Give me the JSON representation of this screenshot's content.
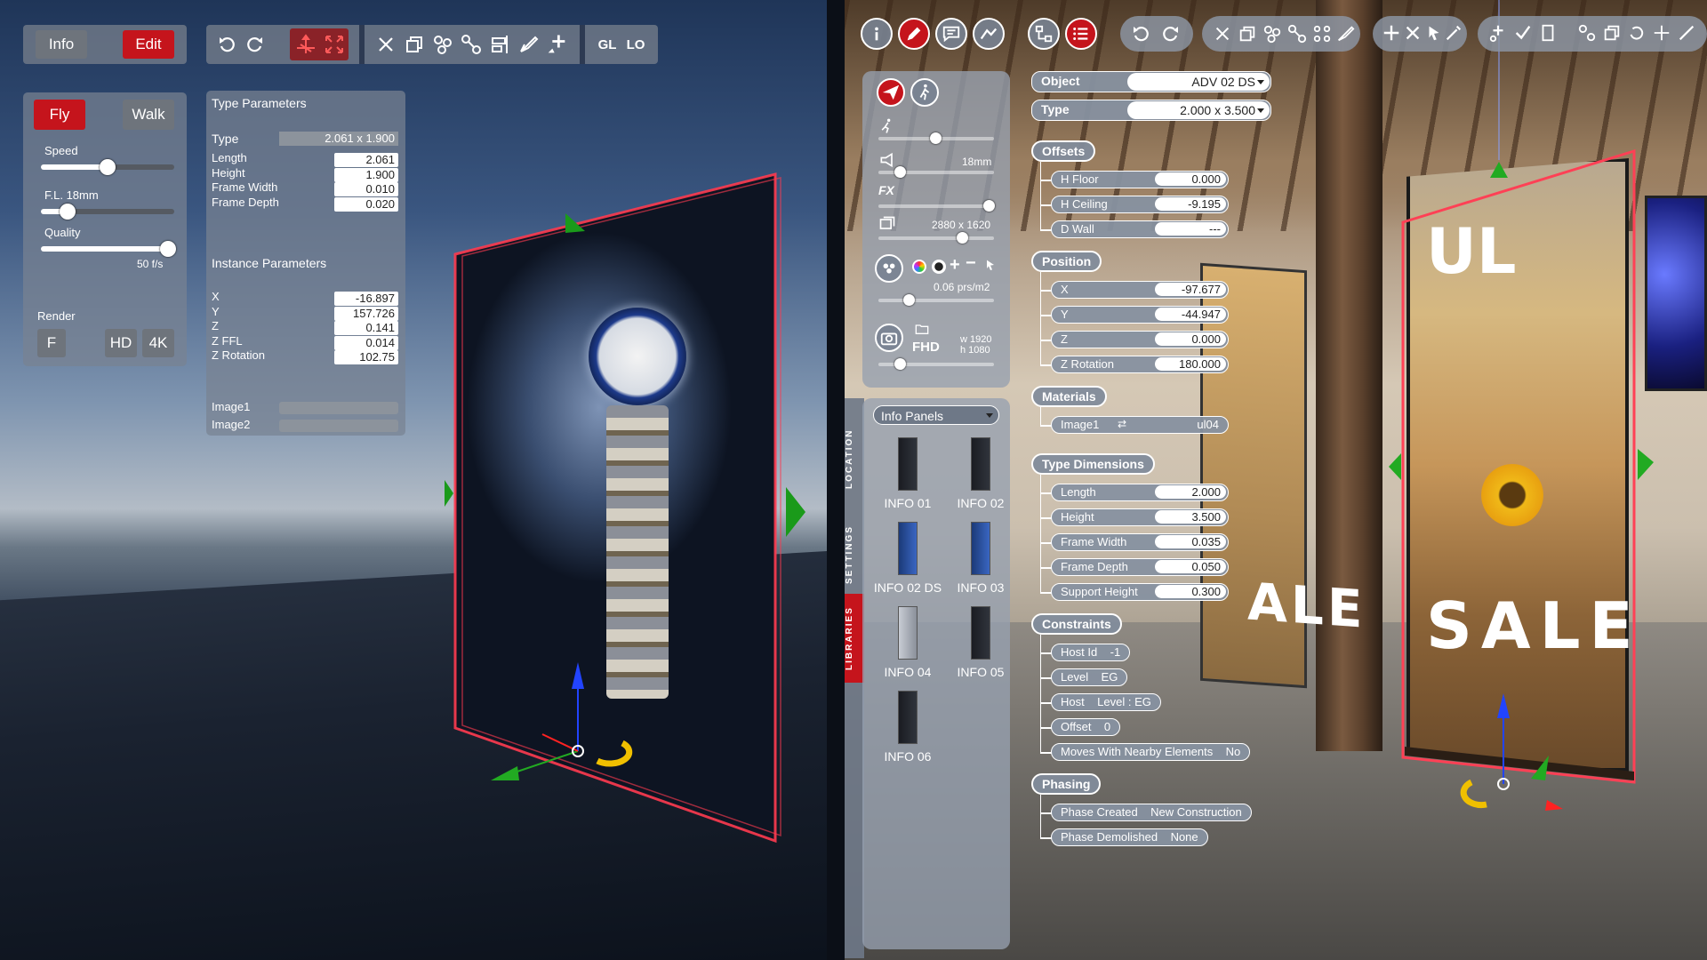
{
  "left": {
    "top_tabs": {
      "info": "Info",
      "edit": "Edit"
    },
    "toolbar2": {
      "gl": "GL",
      "lo": "LO"
    },
    "nav": {
      "fly": "Fly",
      "walk": "Walk",
      "speed_label": "Speed",
      "speed_value": 0.5,
      "fl_label": "F.L. 18mm",
      "fl_value": 0.2,
      "quality_label": "Quality",
      "quality_value": 0.95,
      "fps": "50 f/s",
      "render_label": "Render",
      "render_f": "F",
      "render_hd": "HD",
      "render_4k": "4K"
    },
    "params": {
      "type_title": "Type Parameters",
      "type_label": "Type",
      "type_value": "2.061 x 1.900",
      "type_rows": [
        {
          "label": "Length",
          "value": "2.061"
        },
        {
          "label": "Height",
          "value": "1.900"
        },
        {
          "label": "Frame Width",
          "value": "0.010"
        },
        {
          "label": "Frame Depth",
          "value": "0.020"
        }
      ],
      "instance_title": "Instance Parameters",
      "instance_rows": [
        {
          "label": "X",
          "value": "-16.897"
        },
        {
          "label": "Y",
          "value": "157.726"
        },
        {
          "label": "Z",
          "value": "0.141"
        },
        {
          "label": "Z FFL",
          "value": "0.014"
        },
        {
          "label": "Z Rotation",
          "value": "102.75"
        }
      ],
      "image_rows": [
        {
          "label": "Image1"
        },
        {
          "label": "Image2"
        }
      ]
    }
  },
  "right": {
    "side": {
      "lens": "18mm",
      "resolution": "2880 x 1620",
      "density": "0.06 prs/m2",
      "screenshot_format": "FHD",
      "screenshot_w": "w 1920",
      "screenshot_h": "h 1080",
      "fx": "FX"
    },
    "library": {
      "dropdown": "Info Panels",
      "items": [
        "INFO 01",
        "INFO 02",
        "INFO 02 DS",
        "INFO 03",
        "INFO 04",
        "INFO 05",
        "INFO 06"
      ],
      "vtabs": [
        "LOCATION",
        "SETTINGS",
        "LIBRARIES"
      ]
    },
    "props": {
      "object_label": "Object",
      "object_value": "ADV 02 DS",
      "type_label": "Type",
      "type_value": "2.000 x 3.500",
      "offsets_title": "Offsets",
      "offsets": [
        {
          "label": "H Floor",
          "value": "0.000"
        },
        {
          "label": "H Ceiling",
          "value": "-9.195"
        },
        {
          "label": "D Wall",
          "value": "---"
        }
      ],
      "position_title": "Position",
      "position": [
        {
          "label": "X",
          "value": "-97.677"
        },
        {
          "label": "Y",
          "value": "-44.947"
        },
        {
          "label": "Z",
          "value": "0.000"
        },
        {
          "label": "Z Rotation",
          "value": "180.000"
        }
      ],
      "materials_title": "Materials",
      "material_label": "Image1",
      "material_value": "ul04",
      "dims_title": "Type Dimensions",
      "dims": [
        {
          "label": "Length",
          "value": "2.000"
        },
        {
          "label": "Height",
          "value": "3.500"
        },
        {
          "label": "Frame Width",
          "value": "0.035"
        },
        {
          "label": "Frame Depth",
          "value": "0.050"
        },
        {
          "label": "Support Height",
          "value": "0.300"
        }
      ],
      "constraints_title": "Constraints",
      "constraints": [
        "Host Id    -1",
        "Level    EG",
        "Host    Level : EG",
        "Offset    0",
        "Moves With Nearby Elements    No"
      ],
      "phasing_title": "Phasing",
      "phasing": [
        "Phase Created    New Construction",
        "Phase Demolished    None"
      ]
    },
    "poster": {
      "top_text": "UL",
      "bottom_text": "SALE",
      "back_text": "ALE"
    }
  }
}
